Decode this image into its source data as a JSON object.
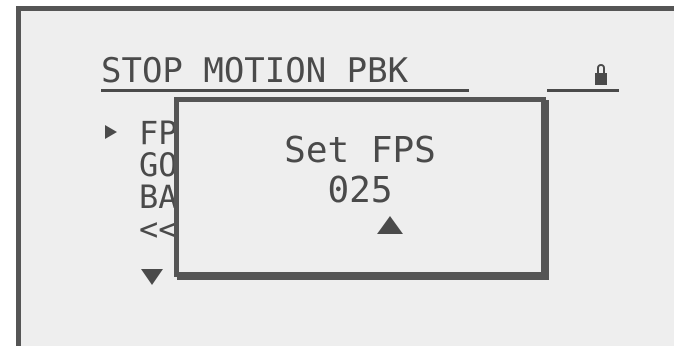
{
  "screen": {
    "title": "STOP MOTION PBK",
    "lock_icon": "lock-icon"
  },
  "menu": {
    "items": [
      {
        "label": "FPS"
      },
      {
        "label": "GO"
      },
      {
        "label": "BACK"
      },
      {
        "label": "<<"
      }
    ],
    "selected_index": 0
  },
  "dialog": {
    "title": "Set FPS",
    "value": "025",
    "increase_icon": "up-arrow-icon"
  },
  "colors": {
    "background": "#eeeeee",
    "foreground": "#4a4a4a",
    "border": "#555555"
  }
}
